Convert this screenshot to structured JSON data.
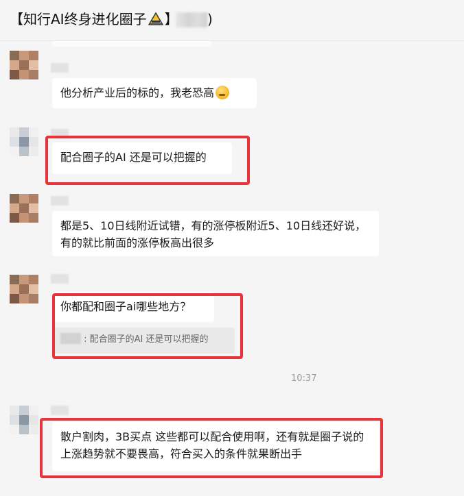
{
  "header": {
    "title": "【知行AI终身进化圈子",
    "title_end": "】",
    "paren": ")"
  },
  "messages": [
    {
      "text": "他分析产业后的标的，我老恐高"
    },
    {
      "text": "配合圈子的AI 还是可以把握的"
    },
    {
      "text": "都是5、10日线附近试错，有的涨停板附近5、10日线还好说，有的就比前面的涨停板高出很多"
    },
    {
      "text": "你都配和圈子ai哪些地方？",
      "quote": "配合圈子的AI 还是可以把握的"
    },
    {
      "text": "散户割肉，3B买点 这些都可以配合使用啊，还有就是圈子说的上涨趋势就不要畏高，符合买入的条件就果断出手"
    }
  ],
  "time": "10:37",
  "colors": {
    "highlight": "#e8333a",
    "bubble": "#ffffff",
    "background": "#f5f5f5"
  },
  "icons": {
    "title_badge": "warning-sign-icon",
    "emoji": "thinking-face-emoji"
  }
}
